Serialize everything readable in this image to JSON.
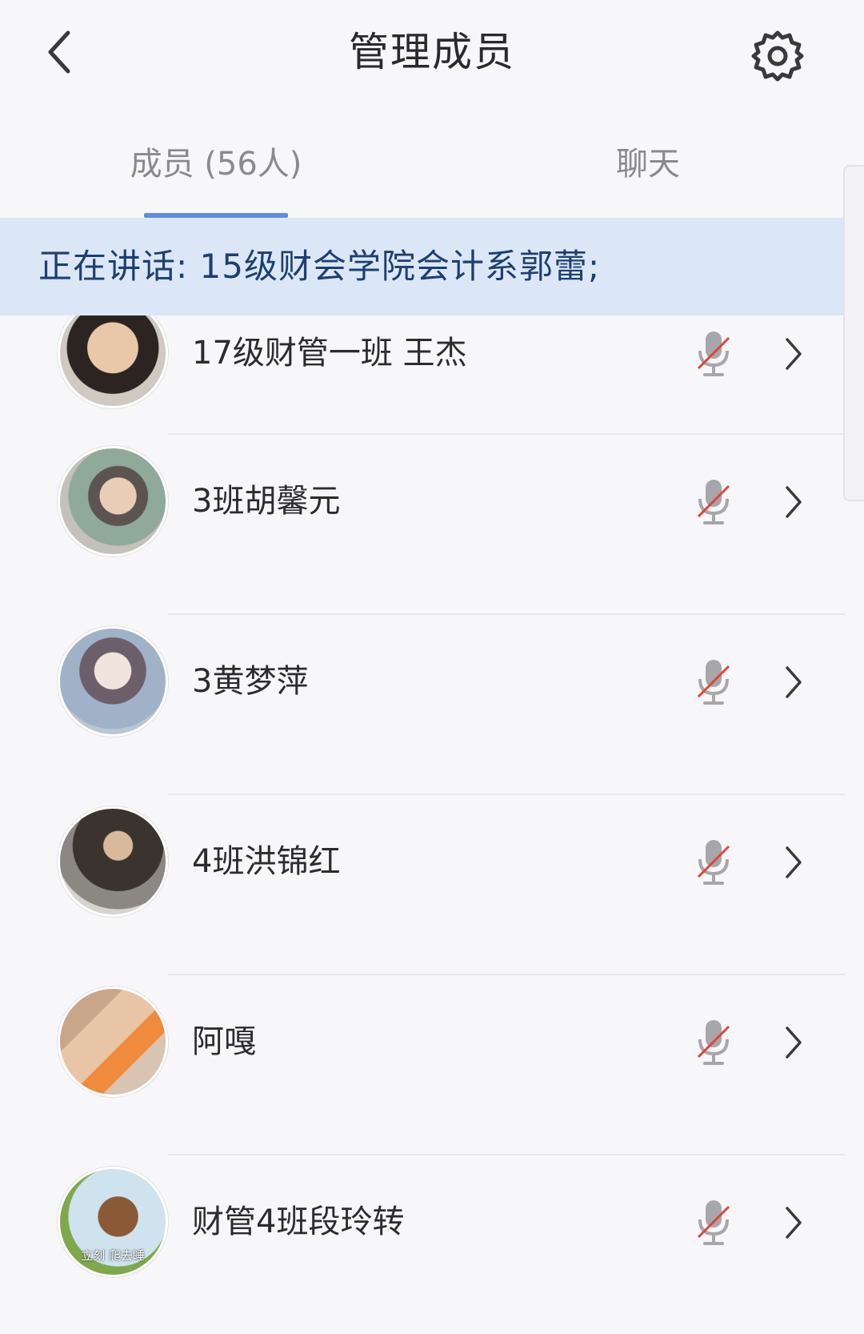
{
  "header": {
    "title": "管理成员",
    "back_icon": "chevron-left-icon",
    "settings_icon": "gear-icon"
  },
  "tabs": [
    {
      "label": "成员 (56人)",
      "active": true
    },
    {
      "label": "聊天",
      "active": false
    }
  ],
  "speaking": {
    "text": "正在讲话: 15级财会学院会计系郭蕾;"
  },
  "members": [
    {
      "name": "17级财管一班 王杰",
      "mic_icon": "mic-muted-icon"
    },
    {
      "name": "3班胡馨元",
      "mic_icon": "mic-muted-icon"
    },
    {
      "name": "3黄梦萍",
      "mic_icon": "mic-muted-icon"
    },
    {
      "name": "4班洪锦红",
      "mic_icon": "mic-muted-icon"
    },
    {
      "name": "阿嘎",
      "mic_icon": "mic-muted-icon"
    },
    {
      "name": "财管4班段玲转",
      "mic_icon": "mic-muted-icon",
      "avatar_caption": "立刻 爬去睡"
    }
  ],
  "colors": {
    "accent": "#5d8de8",
    "banner_bg": "#dbe7f6",
    "banner_text": "#1d3f70",
    "mute_slash": "#e0453a"
  }
}
